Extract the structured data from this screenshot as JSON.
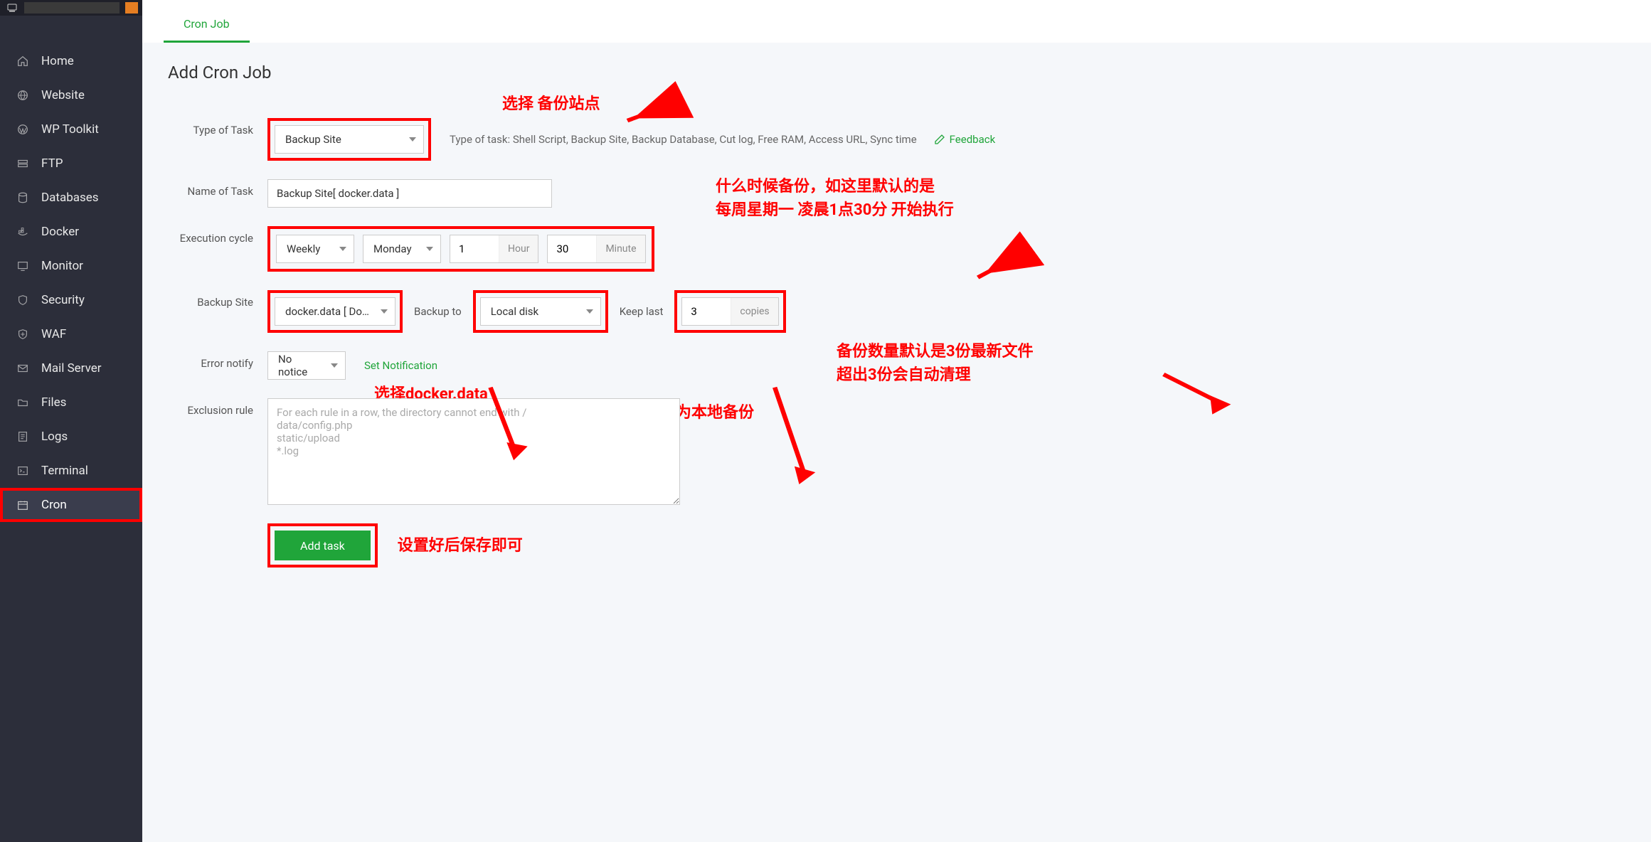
{
  "sidebar": {
    "items": [
      {
        "icon": "home",
        "label": "Home"
      },
      {
        "icon": "globe",
        "label": "Website"
      },
      {
        "icon": "wp",
        "label": "WP Toolkit"
      },
      {
        "icon": "ftp",
        "label": "FTP"
      },
      {
        "icon": "db",
        "label": "Databases"
      },
      {
        "icon": "docker",
        "label": "Docker"
      },
      {
        "icon": "monitor",
        "label": "Monitor"
      },
      {
        "icon": "shield",
        "label": "Security"
      },
      {
        "icon": "waf",
        "label": "WAF"
      },
      {
        "icon": "mail",
        "label": "Mail Server"
      },
      {
        "icon": "folder",
        "label": "Files"
      },
      {
        "icon": "logs",
        "label": "Logs"
      },
      {
        "icon": "terminal",
        "label": "Terminal"
      },
      {
        "icon": "cron",
        "label": "Cron"
      }
    ],
    "activeIndex": 13
  },
  "tabs": {
    "active": "Cron Job"
  },
  "page": {
    "title": "Add Cron Job"
  },
  "form": {
    "typeOfTask": {
      "label": "Type of Task",
      "value": "Backup Site",
      "help": "Type of task: Shell Script, Backup Site, Backup Database, Cut log, Free RAM, Access URL, Sync time",
      "feedback": "Feedback"
    },
    "nameOfTask": {
      "label": "Name of Task",
      "value": "Backup Site[ docker.data ]"
    },
    "execCycle": {
      "label": "Execution cycle",
      "period": "Weekly",
      "day": "Monday",
      "hour": "1",
      "hourSuffix": "Hour",
      "minute": "30",
      "minuteSuffix": "Minute"
    },
    "backupSite": {
      "label": "Backup Site",
      "value": "docker.data [ Dock..."
    },
    "backupTo": {
      "label": "Backup to",
      "value": "Local disk"
    },
    "keepLast": {
      "label": "Keep last",
      "value": "3",
      "suffix": "copies"
    },
    "errorNotify": {
      "label": "Error notify",
      "value": "No notice",
      "link": "Set Notification"
    },
    "exclusion": {
      "label": "Exclusion rule",
      "placeholder": "For each rule in a row, the directory cannot end with /\ndata/config.php\nstatic/upload\n*.log"
    },
    "addBtn": "Add task"
  },
  "annotations": {
    "a1": "选择 备份站点",
    "a2_l1": "什么时候备份，如这里默认的是",
    "a2_l2": "每周星期一 凌晨1点30分 开始执行",
    "a3": "选择docker.data",
    "a4": "备份位置，默认为本地备份",
    "a5_l1": "备份数量默认是3份最新文件",
    "a5_l2": "超出3份会自动清理",
    "a6": "设置好后保存即可"
  }
}
